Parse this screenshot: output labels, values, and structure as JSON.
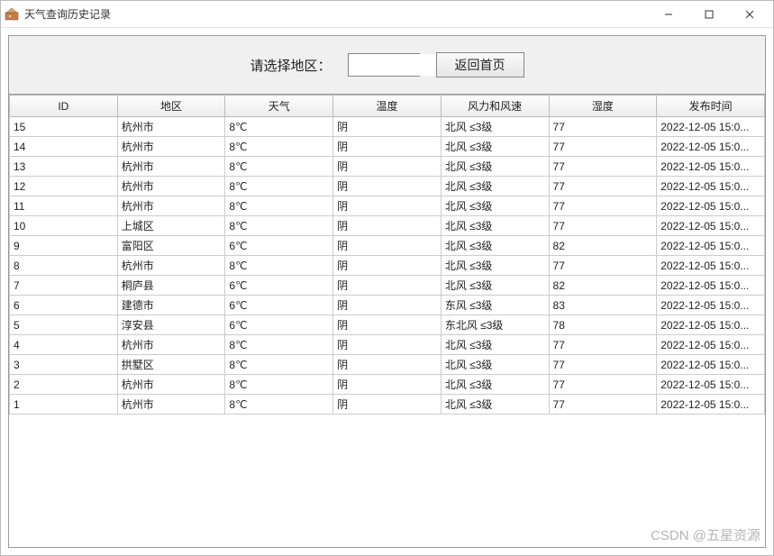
{
  "window": {
    "title": "天气查询历史记录"
  },
  "toolbar": {
    "label": "请选择地区：",
    "combo_value": "",
    "back_button": "返回首页"
  },
  "table": {
    "headers": [
      "ID",
      "地区",
      "天气",
      "温度",
      "风力和风速",
      "湿度",
      "发布时间"
    ],
    "rows": [
      {
        "id": "15",
        "region": "杭州市",
        "weather": "8℃",
        "temp": "阴",
        "wind": "北风 ≤3级",
        "humidity": "77",
        "time": "2022-12-05 15:0..."
      },
      {
        "id": "14",
        "region": "杭州市",
        "weather": "8℃",
        "temp": "阴",
        "wind": "北风 ≤3级",
        "humidity": "77",
        "time": "2022-12-05 15:0..."
      },
      {
        "id": "13",
        "region": "杭州市",
        "weather": "8℃",
        "temp": "阴",
        "wind": "北风 ≤3级",
        "humidity": "77",
        "time": "2022-12-05 15:0..."
      },
      {
        "id": "12",
        "region": "杭州市",
        "weather": "8℃",
        "temp": "阴",
        "wind": "北风 ≤3级",
        "humidity": "77",
        "time": "2022-12-05 15:0..."
      },
      {
        "id": "11",
        "region": "杭州市",
        "weather": "8℃",
        "temp": "阴",
        "wind": "北风 ≤3级",
        "humidity": "77",
        "time": "2022-12-05 15:0..."
      },
      {
        "id": "10",
        "region": "上城区",
        "weather": "8℃",
        "temp": "阴",
        "wind": "北风 ≤3级",
        "humidity": "77",
        "time": "2022-12-05 15:0..."
      },
      {
        "id": "9",
        "region": "富阳区",
        "weather": "6℃",
        "temp": "阴",
        "wind": "北风 ≤3级",
        "humidity": "82",
        "time": "2022-12-05 15:0..."
      },
      {
        "id": "8",
        "region": "杭州市",
        "weather": "8℃",
        "temp": "阴",
        "wind": "北风 ≤3级",
        "humidity": "77",
        "time": "2022-12-05 15:0..."
      },
      {
        "id": "7",
        "region": "桐庐县",
        "weather": "6℃",
        "temp": "阴",
        "wind": "北风 ≤3级",
        "humidity": "82",
        "time": "2022-12-05 15:0..."
      },
      {
        "id": "6",
        "region": "建德市",
        "weather": "6℃",
        "temp": "阴",
        "wind": "东风 ≤3级",
        "humidity": "83",
        "time": "2022-12-05 15:0..."
      },
      {
        "id": "5",
        "region": "淳安县",
        "weather": "6℃",
        "temp": "阴",
        "wind": "东北风 ≤3级",
        "humidity": "78",
        "time": "2022-12-05 15:0..."
      },
      {
        "id": "4",
        "region": "杭州市",
        "weather": "8℃",
        "temp": "阴",
        "wind": "北风 ≤3级",
        "humidity": "77",
        "time": "2022-12-05 15:0..."
      },
      {
        "id": "3",
        "region": "拱墅区",
        "weather": "8℃",
        "temp": "阴",
        "wind": "北风 ≤3级",
        "humidity": "77",
        "time": "2022-12-05 15:0..."
      },
      {
        "id": "2",
        "region": "杭州市",
        "weather": "8℃",
        "temp": "阴",
        "wind": "北风 ≤3级",
        "humidity": "77",
        "time": "2022-12-05 15:0..."
      },
      {
        "id": "1",
        "region": "杭州市",
        "weather": "8℃",
        "temp": "阴",
        "wind": "北风 ≤3级",
        "humidity": "77",
        "time": "2022-12-05 15:0..."
      }
    ]
  },
  "watermark": "CSDN @五星资源"
}
